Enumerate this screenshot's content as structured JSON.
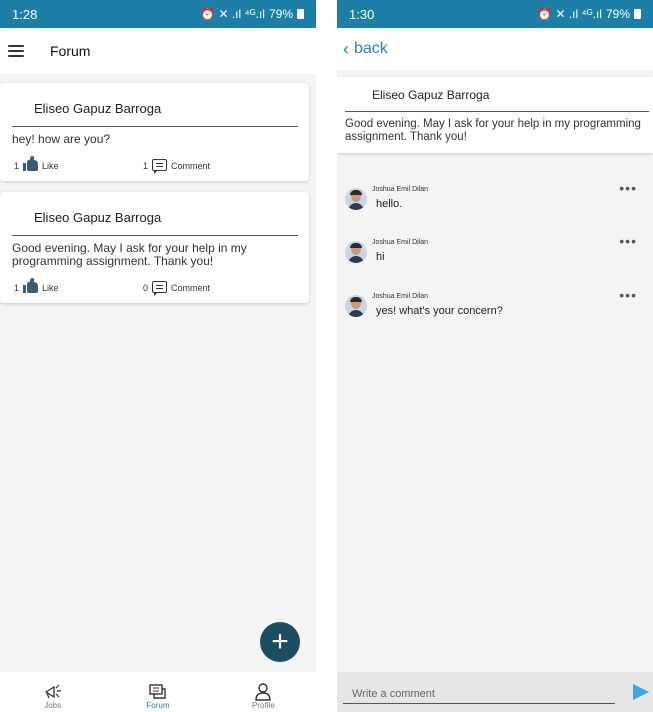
{
  "left": {
    "status": {
      "time": "1:28",
      "icons": "⏰ ✕ .ıl ⁴ᴳ.ıl",
      "battery": "79%"
    },
    "appbar": {
      "title": "Forum"
    },
    "posts": [
      {
        "author": "Eliseo Gapuz Barroga",
        "text": "hey! how are you?",
        "likes": "1",
        "like_label": "Like",
        "comments": "1",
        "comment_label": "Comment"
      },
      {
        "author": "Eliseo Gapuz Barroga",
        "text": "Good evening. May I ask for your help in my programming assignment. Thank you!",
        "likes": "1",
        "like_label": "Like",
        "comments": "0",
        "comment_label": "Comment"
      }
    ],
    "fab": {
      "icon": "+"
    },
    "nav": [
      {
        "label": "Jobs",
        "icon": "megaphone-icon"
      },
      {
        "label": "Forum",
        "icon": "chat-icon",
        "active": true
      },
      {
        "label": "Profile",
        "icon": "person-icon"
      }
    ]
  },
  "right": {
    "status": {
      "time": "1:30",
      "icons": "⏰ ✕ .ıl ⁴ᴳ.ıl",
      "battery": "79%"
    },
    "back": {
      "label": "back"
    },
    "post": {
      "author": "Eliseo Gapuz Barroga",
      "text": "Good evening. May I ask for your help in my programming assignment. Thank you!"
    },
    "comments": [
      {
        "name": "Joshua Emil  Dilan",
        "text": "hello."
      },
      {
        "name": "Joshua Emil  Dilan",
        "text": "hi"
      },
      {
        "name": "Joshua Emil  Dilan",
        "text": "yes! what's your concern?"
      }
    ],
    "composer": {
      "placeholder": "Write a comment"
    }
  },
  "colors": {
    "statusbar": "#1d7ea8",
    "accent": "#2a7fb0",
    "fab": "#1e4c60",
    "send": "#3aa8e0"
  }
}
